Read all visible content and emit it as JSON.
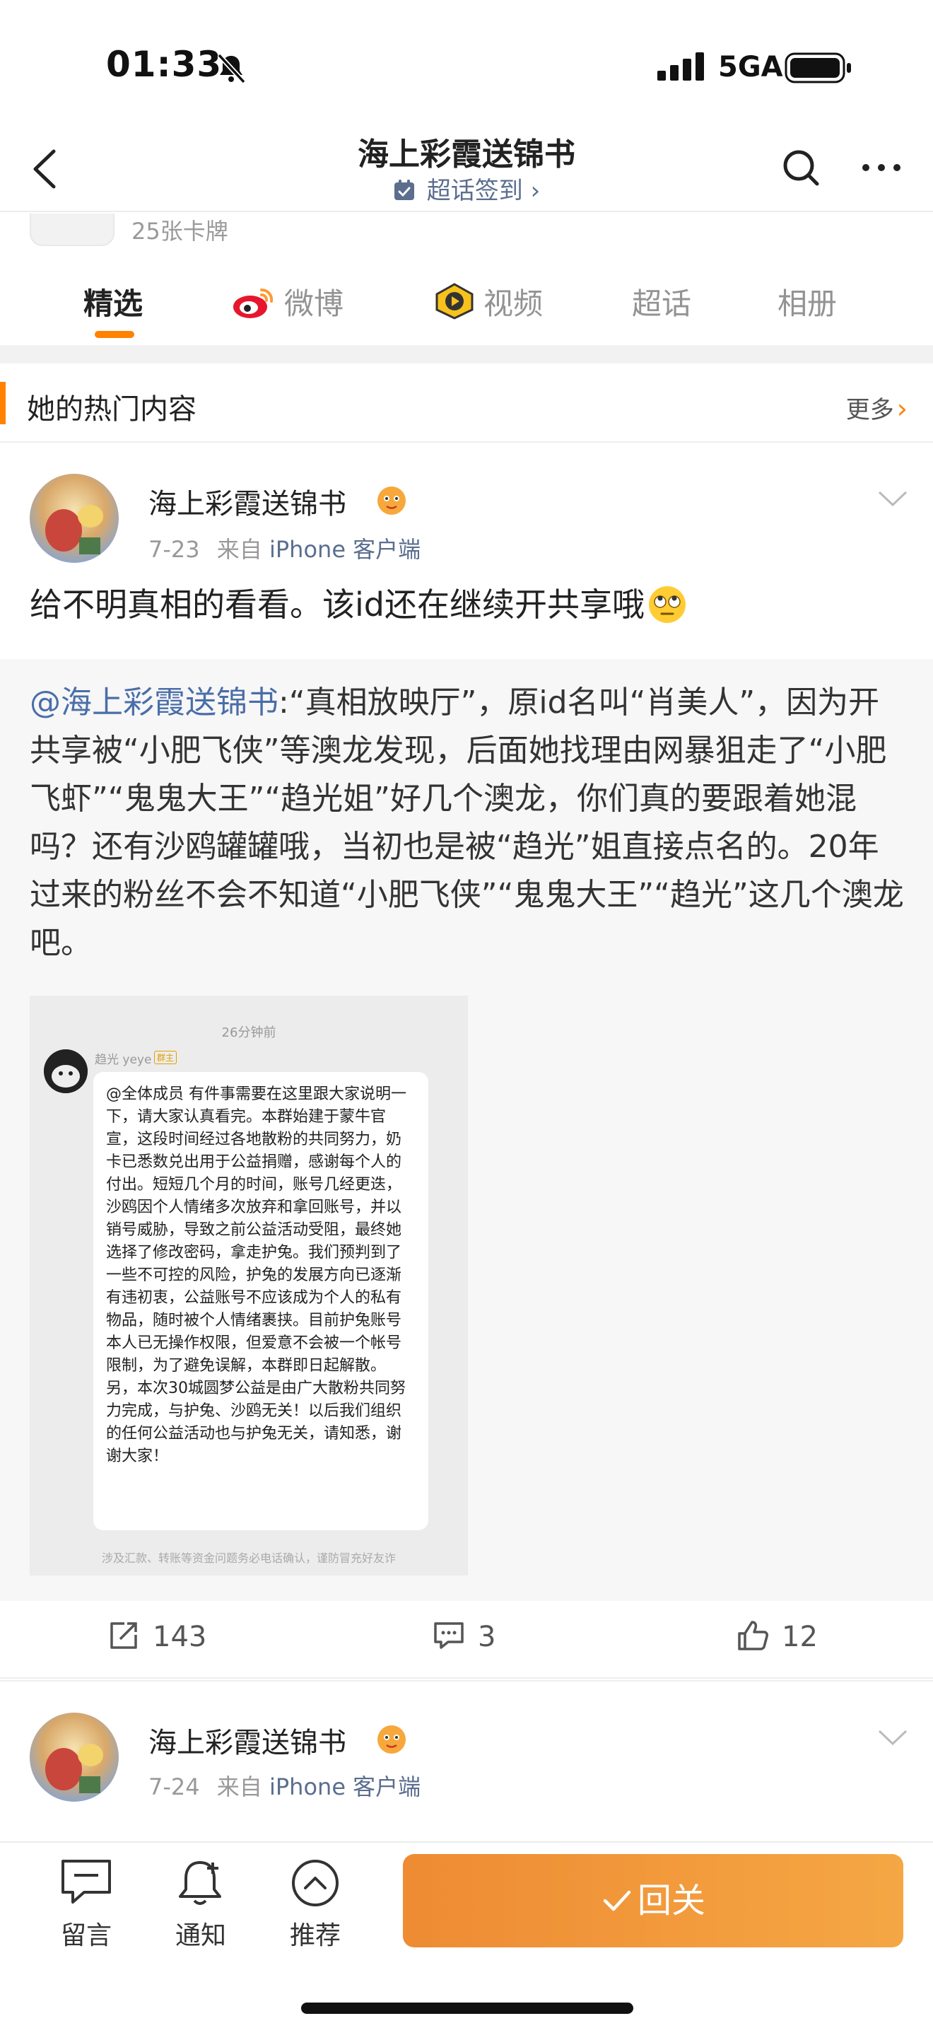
{
  "status_bar": {
    "time": "01:33",
    "network": "5GA"
  },
  "header": {
    "title": "海上彩霞送锦书",
    "checkin": "超话签到 ›"
  },
  "profile": {
    "card_count": "25张卡牌"
  },
  "tabs": [
    {
      "label": "精选",
      "active": true
    },
    {
      "label": "微博"
    },
    {
      "label": "视频"
    },
    {
      "label": "超话"
    },
    {
      "label": "相册"
    }
  ],
  "section": {
    "title": "她的热门内容",
    "more": "更多"
  },
  "post1": {
    "author": "海上彩霞送锦书",
    "date": "7-23",
    "via": "来自",
    "source": "iPhone 客户端",
    "text": "给不明真相的看看。该id还在继续开共享哦",
    "repost": {
      "mention": "@海上彩霞送锦书",
      "text": ":“真相放映厅”，原id名叫“肖美人”，因为开共享被“小肥飞侠”等澳龙发现，后面她找理由网暴狙走了“小肥飞虾”“鬼鬼大王”“趋光姐”好几个澳龙，你们真的要跟着她混吗？还有沙鸥罐罐哦，当初也是被“趋光”姐直接点名的。20年过来的粉丝不会不知道“小肥飞侠”“鬼鬼大王”“趋光”这几个澳龙吧。",
      "image": {
        "time": "26分钟前",
        "sender": "趋光 yeye",
        "tag": "群主",
        "message": "@全体成员 有件事需要在这里跟大家说明一下，请大家认真看完。本群始建于蒙牛官宣，这段时间经过各地散粉的共同努力，奶卡已悉数兑出用于公益捐赠，感谢每个人的付出。短短几个月的时间，账号几经更迭，沙鸥因个人情绪多次放弃和拿回账号，并以销号威胁，导致之前公益活动受阻，最终她选择了修改密码，拿走护兔。我们预判到了一些不可控的风险，护兔的发展方向已逐渐有违初衷，公益账号不应该成为个人的私有物品，随时被个人情绪裹挟。目前护兔账号本人已无操作权限，但爱意不会被一个帐号限制，为了避免误解，本群即日起解散。另，本次30城圆梦公益是由广大散粉共同努力完成，与护兔、沙鸥无关！以后我们组织的任何公益活动也与护兔无关，请知悉，谢谢大家！",
        "footer": "涉及汇款、转账等资金问题务必电话确认，谨防冒充好友诈"
      }
    },
    "reposts": "143",
    "comments": "3",
    "likes": "12"
  },
  "post2": {
    "author": "海上彩霞送锦书",
    "date": "7-24",
    "via": "来自",
    "source": "iPhone 客户端"
  },
  "bottom_bar": {
    "message": "留言",
    "notify": "通知",
    "recommend": "推荐",
    "follow": "回关"
  },
  "colors": {
    "accent": "#ff8200",
    "link": "#4a6ea8",
    "follow_start": "#ee8b33",
    "follow_end": "#f5a744"
  }
}
